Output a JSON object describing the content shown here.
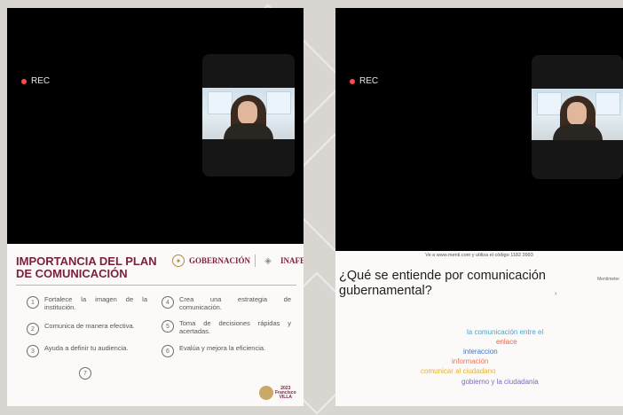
{
  "left_panel": {
    "rec_label": "REC",
    "slide": {
      "title": "IMPORTANCIA DEL PLAN DE COMUNICACIÓN",
      "logo_gobernacion": "GOBERNACIÓN",
      "logo_inafed": "INAFED",
      "items": [
        {
          "number": "1",
          "text": "Fortalece la imagen de la institución."
        },
        {
          "number": "2",
          "text": "Comunica de manera efectiva."
        },
        {
          "number": "3",
          "text": "Ayuda a definir tu audiencia."
        },
        {
          "number": "4",
          "text": "Crea una estrategia de comunicación."
        },
        {
          "number": "5",
          "text": "Toma de decisiones rápidas y acertadas."
        },
        {
          "number": "6",
          "text": "Evalúa y mejora la eficiencia."
        },
        {
          "number": "7",
          "text": ""
        }
      ],
      "year_logo": {
        "year": "2023",
        "line1": "Francisco",
        "line2": "VILLA"
      }
    }
  },
  "right_panel": {
    "rec_label": "REC",
    "slide": {
      "menti_code": "Ve a www.menti.com y utiliza el código 1182 3993",
      "menti_logo": "Mentimeter",
      "question": "¿Qué se entiende por comunicación gubernamental?",
      "cursor_mark": "›",
      "words": [
        {
          "text": "la comunicación entre el",
          "color": "#4aa6cf"
        },
        {
          "text": "enlace",
          "color": "#e6624e"
        },
        {
          "text": "interaccion",
          "color": "#3a78c8"
        },
        {
          "text": "información",
          "color": "#e5795f"
        },
        {
          "text": "comunicar al ciudadano",
          "color": "#e5b23a"
        },
        {
          "text": "gobierno y la ciudadania",
          "color": "#7b6bb8"
        }
      ]
    }
  },
  "colors": {
    "accent_burgundy": "#7a1f3d",
    "gold": "#b38b4d",
    "rec_dot": "#ff4a4a"
  },
  "icons": [
    "rec-dot-icon",
    "gobernacion-emblem-icon",
    "inafed-mark-icon",
    "year-emblem-icon"
  ]
}
